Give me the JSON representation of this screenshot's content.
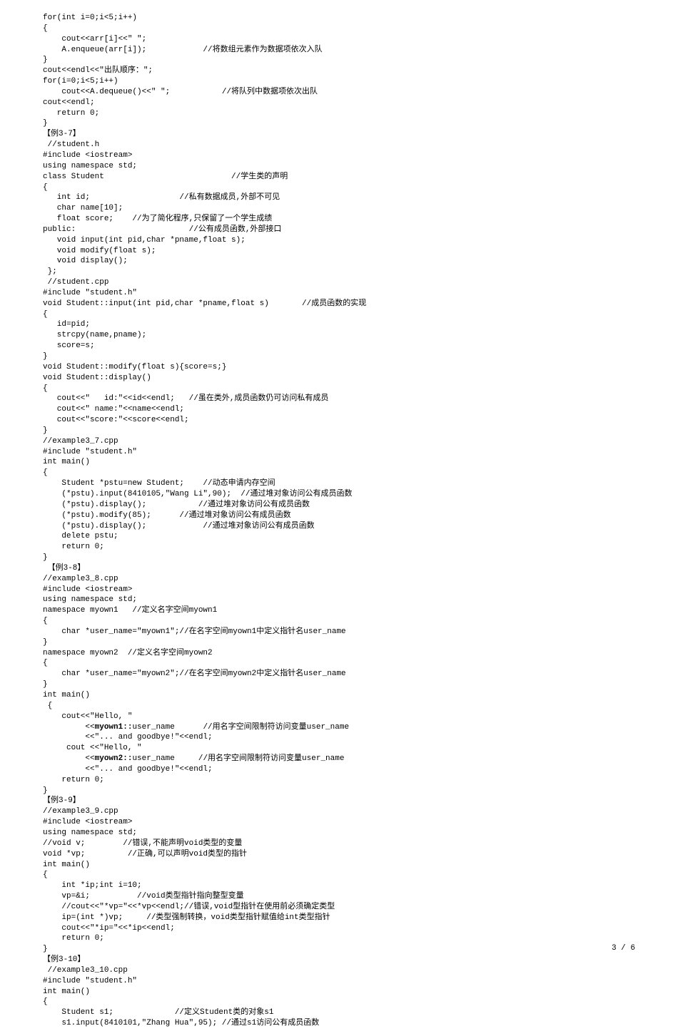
{
  "footer": "3 / 6",
  "lines": [
    "for(int i=0;i<5;i++)",
    "{",
    "    cout<<arr[i]<<\" \";",
    "    A.enqueue(arr[i]);            //将数组元素作为数据项依次入队",
    "}",
    "cout<<endl<<\"出队顺序：\";",
    "for(i=0;i<5;i++)",
    "    cout<<A.dequeue()<<\" \";           //将队列中数据项依次出队",
    "cout<<endl;",
    "   return 0;",
    "}",
    "【例3-7】",
    " //student.h",
    "#include <iostream>",
    "using namespace std;",
    "class Student                           //学生类的声明",
    "{",
    "   int id;                   //私有数据成员,外部不可见",
    "   char name[10];",
    "   float score;    //为了简化程序,只保留了一个学生成绩",
    "public:                        //公有成员函数,外部接口",
    "   void input(int pid,char *pname,float s);",
    "   void modify(float s);",
    "   void display();",
    " };",
    " //student.cpp",
    "#include \"student.h\"",
    "void Student::input(int pid,char *pname,float s)       //成员函数的实现",
    "{",
    "   id=pid;",
    "   strcpy(name,pname);",
    "   score=s;",
    "}",
    "void Student::modify(float s){score=s;}",
    "void Student::display()",
    "{",
    "   cout<<\"   id:\"<<id<<endl;   //虽在类外,成员函数仍可访问私有成员",
    "   cout<<\" name:\"<<name<<endl;",
    "   cout<<\"score:\"<<score<<endl;",
    "}",
    "//example3_7.cpp",
    "#include \"student.h\"",
    "int main()",
    "{",
    "    Student *pstu=new Student;    //动态申请内存空间",
    "    (*pstu).input(8410105,\"Wang Li\",90);  //通过堆对象访问公有成员函数",
    "    (*pstu).display();           //通过堆对象访问公有成员函数",
    "    (*pstu).modify(85);      //通过堆对象访问公有成员函数",
    "    (*pstu).display();            //通过堆对象访问公有成员函数",
    "    delete pstu;",
    "    return 0;",
    "}",
    " 【例3-8】",
    "//example3_8.cpp",
    "#include <iostream>",
    "using namespace std;",
    "namespace myown1   //定义名字空间myown1",
    "{",
    "    char *user_name=\"myown1\";//在名字空间myown1中定义指针名user_name",
    "}",
    "namespace myown2  //定义名字空间myown2",
    "{",
    "    char *user_name=\"myown2\";//在名字空间myown2中定义指针名user_name",
    "}",
    "int main()",
    " {",
    "    cout<<\"Hello, \"",
    "         <<<b>myown1::</b>user_name      //用名字空间限制符访问变量user_name",
    "         <<\"... and goodbye!\"<<endl;",
    "     cout <<\"Hello, \"",
    "         <<<b>myown2::</b>user_name     //用名字空间限制符访问变量user_name",
    "         <<\"... and goodbye!\"<<endl;",
    "    return 0;",
    "}",
    "【例3-9】",
    "//example3_9.cpp",
    "#include <iostream>",
    "using namespace std;",
    "//void v;        //错误,不能声明void类型的变量",
    "void *vp;         //正确,可以声明void类型的指针",
    "int main()",
    "{",
    "    int *ip;int i=10;",
    "    vp=&i;          //void类型指针指向整型变量",
    "    //cout<<\"*vp=\"<<*vp<<endl;//错误,void型指针在使用前必须确定类型",
    "    ip=(int *)vp;     //类型强制转换，void类型指针赋值给int类型指针",
    "    cout<<\"*ip=\"<<*ip<<endl;",
    "    return 0;",
    "}",
    "【例3-10】",
    " //example3_10.cpp",
    "#include \"student.h\"",
    "int main()",
    "{",
    "    Student s1;             //定义Student类的对象s1",
    "    s1.input(8410101,\"Zhang Hua\",95); //通过s1访问公有成员函数"
  ]
}
